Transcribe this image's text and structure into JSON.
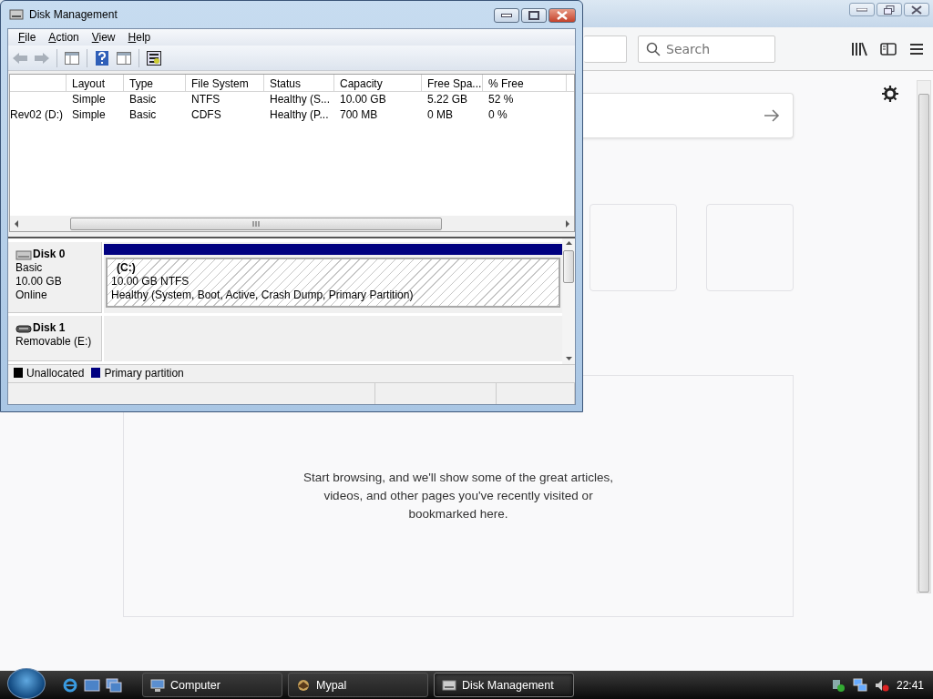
{
  "browser": {
    "search": {
      "placeholder": "Search"
    },
    "empty_message": "Start browsing, and we'll show some of the great articles, videos, and other pages you've recently visited or bookmarked here."
  },
  "disk_management": {
    "title": "Disk Management",
    "menu": [
      "File",
      "Action",
      "View",
      "Help"
    ],
    "columns": [
      "Layout",
      "Type",
      "File System",
      "Status",
      "Capacity",
      "Free Spa...",
      "% Free"
    ],
    "rows": [
      {
        "cells": [
          "Simple",
          "Basic",
          "NTFS",
          "Healthy (S...",
          "10.00 GB",
          "5.22 GB",
          "52 %"
        ]
      },
      {
        "volume": "Rev02 (D:)",
        "cells": [
          "Simple",
          "Basic",
          "CDFS",
          "Healthy (P...",
          "700 MB",
          "0 MB",
          "0 %"
        ]
      }
    ],
    "disks": [
      {
        "name": "Disk 0",
        "kind": "fixed",
        "lines": [
          "Basic",
          "10.00 GB",
          "Online"
        ],
        "partition": {
          "label": "(C:)",
          "size": "10.00 GB NTFS",
          "status": "Healthy (System, Boot, Active, Crash Dump, Primary Partition)"
        }
      },
      {
        "name": "Disk 1",
        "kind": "removable",
        "lines": [
          "Removable (E:)"
        ]
      }
    ],
    "legend": [
      {
        "label": "Unallocated",
        "color": "#000000"
      },
      {
        "label": "Primary partition",
        "color": "#000080"
      }
    ]
  },
  "taskbar": {
    "buttons": [
      {
        "label": "Computer",
        "kind": "computer",
        "selected": false
      },
      {
        "label": "Mypal",
        "kind": "browser",
        "selected": false
      },
      {
        "label": "Disk Management",
        "kind": "disk",
        "selected": true
      }
    ],
    "clock": "22:41"
  }
}
